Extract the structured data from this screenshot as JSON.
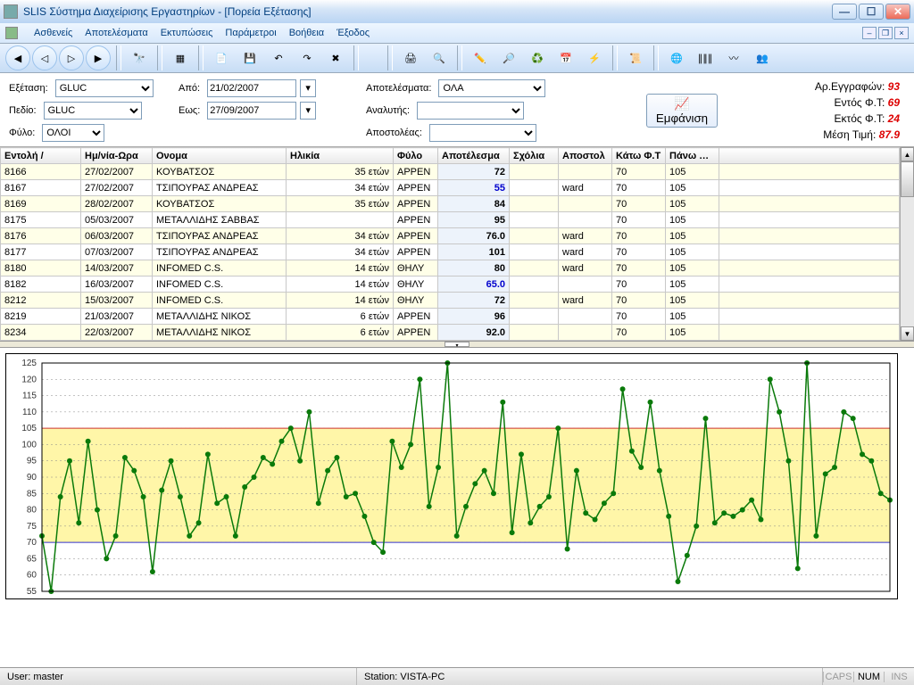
{
  "window": {
    "title": "SLIS Σύστημα Διαχείρισης Εργαστηρίων - [Πορεία Εξέτασης]"
  },
  "menu": {
    "items": [
      "Ασθενείς",
      "Αποτελέσματα",
      "Εκτυπώσεις",
      "Παράμετροι",
      "Βοήθεια",
      "Έξοδος"
    ]
  },
  "filters": {
    "exam_label": "Εξέταση:",
    "exam_value": "GLUC",
    "field_label": "Πεδίο:",
    "field_value": "GLUC",
    "sex_label": "Φύλο:",
    "sex_value": "ΟΛΟΙ",
    "from_label": "Από:",
    "from_value": "21/02/2007",
    "to_label": "Εως:",
    "to_value": "27/09/2007",
    "results_label": "Αποτελέσματα:",
    "results_value": "ΟΛΑ",
    "analyzer_label": "Αναλυτής:",
    "analyzer_value": "",
    "sender_label": "Αποστολέας:",
    "sender_value": "",
    "show_btn": "Εμφάνιση"
  },
  "stats": {
    "rec_label": "Αρ.Εγγραφών:",
    "rec_val": "93",
    "in_label": "Εντός Φ.Τ:",
    "in_val": "69",
    "out_label": "Εκτός Φ.Τ:",
    "out_val": "24",
    "avg_label": "Μέση Τιμή:",
    "avg_val": "87.9"
  },
  "columns": [
    "Εντολή /",
    "Ημ/νία-Ωρα",
    "Ονομα",
    "Ηλικία",
    "Φύλο",
    "Αποτέλεσμα",
    "Σχόλια",
    "Αποστολ",
    "Κάτω Φ.Τ",
    "Πάνω Φ.Τ"
  ],
  "rows": [
    {
      "id": "8166",
      "date": "27/02/2007",
      "name": "ΚΟΥΒΑΤΣΟΣ",
      "age": "35 ετών",
      "sex": "ΑΡΡΕΝ",
      "res": "72",
      "blue": false,
      "sch": "",
      "sender": "",
      "lo": "70",
      "hi": "105"
    },
    {
      "id": "8167",
      "date": "27/02/2007",
      "name": "ΤΣΙΠΟΥΡΑΣ ΑΝΔΡΕΑΣ",
      "age": "34 ετών",
      "sex": "ΑΡΡΕΝ",
      "res": "55",
      "blue": true,
      "sch": "",
      "sender": "ward",
      "lo": "70",
      "hi": "105"
    },
    {
      "id": "8169",
      "date": "28/02/2007",
      "name": "ΚΟΥΒΑΤΣΟΣ",
      "age": "35 ετών",
      "sex": "ΑΡΡΕΝ",
      "res": "84",
      "blue": false,
      "sch": "",
      "sender": "",
      "lo": "70",
      "hi": "105"
    },
    {
      "id": "8175",
      "date": "05/03/2007",
      "name": "ΜΕΤΑΛΛΙΔΗΣ ΣΑΒΒΑΣ",
      "age": "",
      "sex": "ΑΡΡΕΝ",
      "res": "95",
      "blue": false,
      "sch": "",
      "sender": "",
      "lo": "70",
      "hi": "105"
    },
    {
      "id": "8176",
      "date": "06/03/2007",
      "name": "ΤΣΙΠΟΥΡΑΣ ΑΝΔΡΕΑΣ",
      "age": "34 ετών",
      "sex": "ΑΡΡΕΝ",
      "res": "76.0",
      "blue": false,
      "sch": "",
      "sender": "ward",
      "lo": "70",
      "hi": "105"
    },
    {
      "id": "8177",
      "date": "07/03/2007",
      "name": "ΤΣΙΠΟΥΡΑΣ ΑΝΔΡΕΑΣ",
      "age": "34 ετών",
      "sex": "ΑΡΡΕΝ",
      "res": "101",
      "blue": false,
      "sch": "",
      "sender": "ward",
      "lo": "70",
      "hi": "105"
    },
    {
      "id": "8180",
      "date": "14/03/2007",
      "name": "INFOMED C.S.",
      "age": "14 ετών",
      "sex": "ΘΗΛΥ",
      "res": "80",
      "blue": false,
      "sch": "",
      "sender": "ward",
      "lo": "70",
      "hi": "105"
    },
    {
      "id": "8182",
      "date": "16/03/2007",
      "name": "INFOMED C.S.",
      "age": "14 ετών",
      "sex": "ΘΗΛΥ",
      "res": "65.0",
      "blue": true,
      "sch": "",
      "sender": "",
      "lo": "70",
      "hi": "105"
    },
    {
      "id": "8212",
      "date": "15/03/2007",
      "name": "INFOMED C.S.",
      "age": "14 ετών",
      "sex": "ΘΗΛΥ",
      "res": "72",
      "blue": false,
      "sch": "",
      "sender": "ward",
      "lo": "70",
      "hi": "105"
    },
    {
      "id": "8219",
      "date": "21/03/2007",
      "name": "ΜΕΤΑΛΛΙΔΗΣ ΝΙΚΟΣ",
      "age": "6 ετών",
      "sex": "ΑΡΡΕΝ",
      "res": "96",
      "blue": false,
      "sch": "",
      "sender": "",
      "lo": "70",
      "hi": "105"
    },
    {
      "id": "8234",
      "date": "22/03/2007",
      "name": "ΜΕΤΑΛΛΙΔΗΣ ΝΙΚΟΣ",
      "age": "6 ετών",
      "sex": "ΑΡΡΕΝ",
      "res": "92.0",
      "blue": false,
      "sch": "",
      "sender": "",
      "lo": "70",
      "hi": "105"
    }
  ],
  "status": {
    "user_label": "User:",
    "user": "master",
    "station_label": "Station:",
    "station": "VISTA-PC",
    "caps": "CAPS",
    "num": "NUM",
    "ins": "INS"
  },
  "chart_data": {
    "type": "line",
    "lo": 70,
    "hi": 105,
    "ylim": [
      55,
      125
    ],
    "ystep": 5,
    "values": [
      72,
      55,
      84,
      95,
      76,
      101,
      80,
      65,
      72,
      96,
      92,
      84,
      61,
      86,
      95,
      84,
      72,
      76,
      97,
      82,
      84,
      72,
      87,
      90,
      96,
      94,
      101,
      105,
      95,
      110,
      82,
      92,
      96,
      84,
      85,
      78,
      70,
      67,
      101,
      93,
      100,
      120,
      81,
      93,
      125,
      72,
      81,
      88,
      92,
      85,
      113,
      73,
      97,
      76,
      81,
      84,
      105,
      68,
      92,
      79,
      77,
      82,
      85,
      117,
      98,
      93,
      113,
      92,
      78,
      58,
      66,
      75,
      108,
      76,
      79,
      78,
      80,
      83,
      77,
      120,
      110,
      95,
      62,
      125,
      72,
      91,
      93,
      110,
      108,
      97,
      95,
      85,
      83
    ]
  }
}
